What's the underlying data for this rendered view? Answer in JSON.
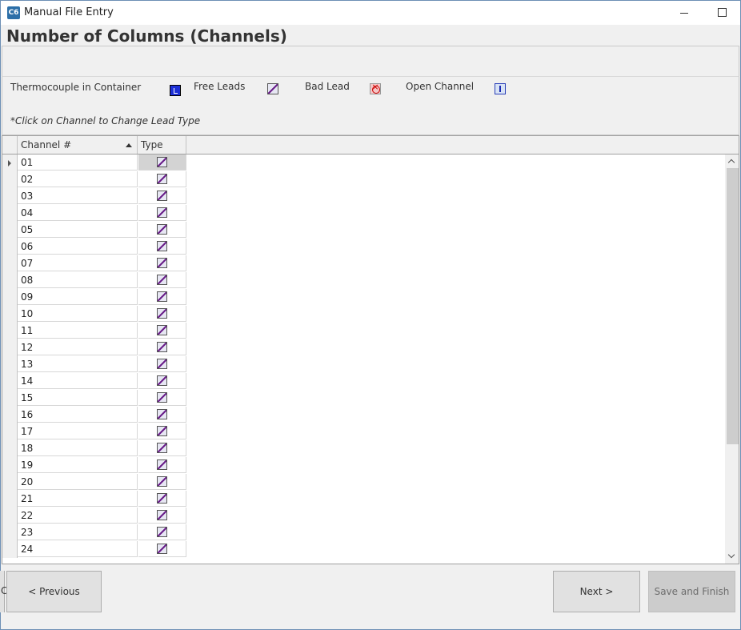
{
  "window": {
    "title": "Manual File Entry",
    "app_icon_text": "C6"
  },
  "heading": "Number of Columns (Channels)",
  "legend": {
    "items": [
      {
        "label": "Thermocouple in Container",
        "icon": "thermocouple-in-container-icon"
      },
      {
        "label": "Free Leads",
        "icon": "free-leads-icon"
      },
      {
        "label": "Bad Lead",
        "icon": "bad-lead-icon"
      },
      {
        "label": "Open Channel",
        "icon": "open-channel-icon"
      }
    ],
    "hint": "*Click on Channel to Change Lead Type"
  },
  "grid": {
    "columns": [
      "Channel #",
      "Type"
    ],
    "sorted_column": "Channel #",
    "sort_direction": "ascending",
    "current_row": "01",
    "rows": [
      {
        "channel": "01",
        "type": "free-leads-icon"
      },
      {
        "channel": "02",
        "type": "free-leads-icon"
      },
      {
        "channel": "03",
        "type": "free-leads-icon"
      },
      {
        "channel": "04",
        "type": "free-leads-icon"
      },
      {
        "channel": "05",
        "type": "free-leads-icon"
      },
      {
        "channel": "06",
        "type": "free-leads-icon"
      },
      {
        "channel": "07",
        "type": "free-leads-icon"
      },
      {
        "channel": "08",
        "type": "free-leads-icon"
      },
      {
        "channel": "09",
        "type": "free-leads-icon"
      },
      {
        "channel": "10",
        "type": "free-leads-icon"
      },
      {
        "channel": "11",
        "type": "free-leads-icon"
      },
      {
        "channel": "12",
        "type": "free-leads-icon"
      },
      {
        "channel": "13",
        "type": "free-leads-icon"
      },
      {
        "channel": "14",
        "type": "free-leads-icon"
      },
      {
        "channel": "15",
        "type": "free-leads-icon"
      },
      {
        "channel": "16",
        "type": "free-leads-icon"
      },
      {
        "channel": "17",
        "type": "free-leads-icon"
      },
      {
        "channel": "18",
        "type": "free-leads-icon"
      },
      {
        "channel": "19",
        "type": "free-leads-icon"
      },
      {
        "channel": "20",
        "type": "free-leads-icon"
      },
      {
        "channel": "21",
        "type": "free-leads-icon"
      },
      {
        "channel": "22",
        "type": "free-leads-icon"
      },
      {
        "channel": "23",
        "type": "free-leads-icon"
      },
      {
        "channel": "24",
        "type": "free-leads-icon"
      }
    ]
  },
  "footer": {
    "clipped_left_text": "C",
    "previous_label": "<  Previous",
    "next_label": "Next  >",
    "save_label": "Save and Finish"
  }
}
